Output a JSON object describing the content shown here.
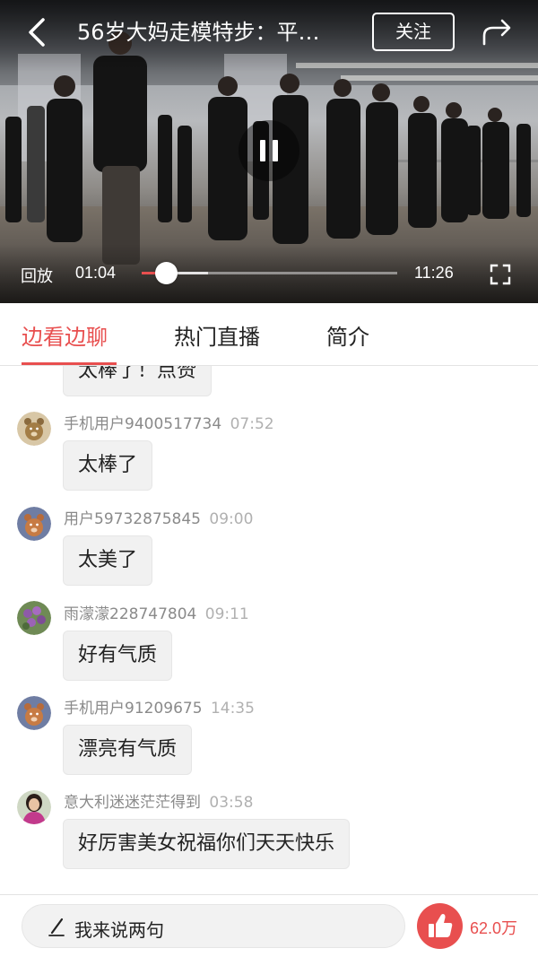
{
  "header": {
    "title": "56岁大妈走模特步：平…",
    "follow_label": "关注"
  },
  "player": {
    "replay_label": "回放",
    "current_time": "01:04",
    "total_time": "11:26",
    "progress_played": 0.093,
    "progress_buffered": 0.26
  },
  "tabs": [
    {
      "label": "边看边聊",
      "active": true
    },
    {
      "label": "热门直播",
      "active": false
    },
    {
      "label": "简介",
      "active": false
    }
  ],
  "messages": [
    {
      "user": "",
      "time": "",
      "text": "太棒了！点赞",
      "avatar": ""
    },
    {
      "user": "手机用户9400517734",
      "time": "07:52",
      "text": "太棒了",
      "avatar": "bear-avatar-beige"
    },
    {
      "user": "用户59732875845",
      "time": "09:00",
      "text": "太美了",
      "avatar": "bear-avatar-blue"
    },
    {
      "user": "雨濛濛228747804",
      "time": "09:11",
      "text": "好有气质",
      "avatar": "flower-photo-avatar"
    },
    {
      "user": "手机用户91209675",
      "time": "14:35",
      "text": "漂亮有气质",
      "avatar": "bear-avatar-blue"
    },
    {
      "user": "意大利迷迷茫茫得到",
      "time": "03:58",
      "text": "好厉害美女祝福你们天天快乐",
      "avatar": "woman-photo-avatar"
    }
  ],
  "bottom_bar": {
    "comment_placeholder": "我来说两句",
    "like_count": "62.0万"
  },
  "colors": {
    "accent": "#e84f4f",
    "bubble_bg": "#f1f1f1",
    "meta_text": "#8a8a8a"
  },
  "icons": {
    "back": "chevron-left-icon",
    "share": "share-arrow-icon",
    "pause": "pause-icon",
    "fullscreen": "fullscreen-icon",
    "pen": "pen-icon",
    "like": "thumbs-up-icon"
  }
}
